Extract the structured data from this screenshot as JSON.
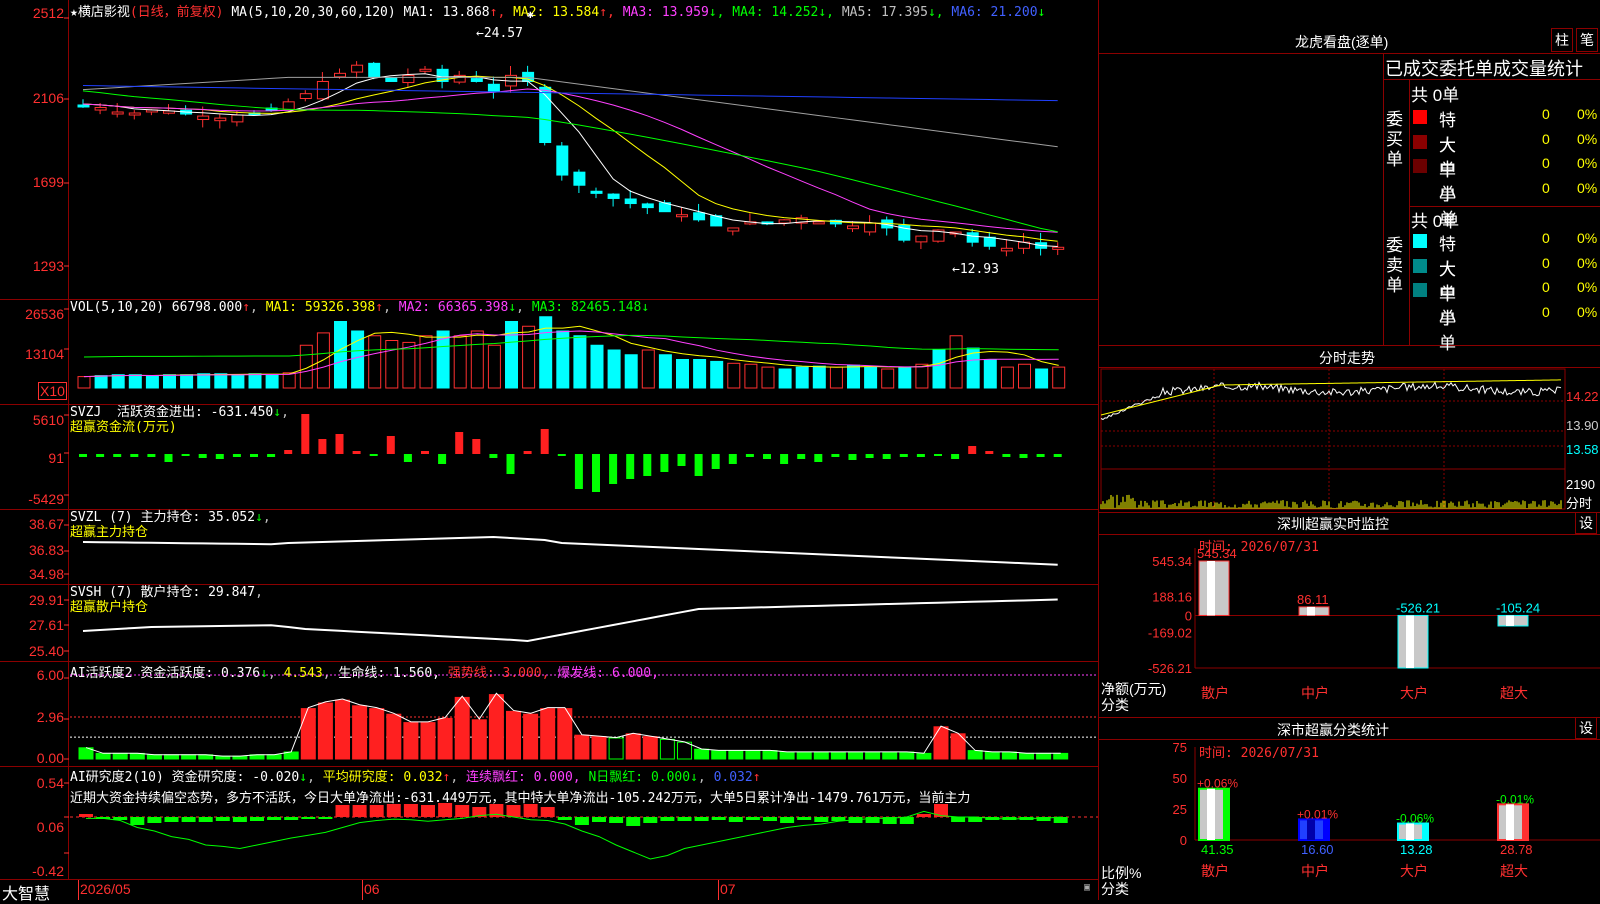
{
  "stock": {
    "name": "横店影视",
    "mode": "(日线，前复权)"
  },
  "main": {
    "ma_prefix": "MA(5,10,20,30,60,120)",
    "ma": [
      {
        "label": "MA1:",
        "value": "13.868",
        "arrow": "↑",
        "color": "#ffffff"
      },
      {
        "label": "MA2:",
        "value": "13.584",
        "arrow": "↑",
        "color": "#ffff00"
      },
      {
        "label": "MA3:",
        "value": "13.959",
        "arrow": "↓",
        "color": "#ff40ff"
      },
      {
        "label": "MA4:",
        "value": "14.252",
        "arrow": "↓",
        "color": "#00ff00"
      },
      {
        "label": "MA5:",
        "value": "17.395",
        "arrow": "↓",
        "color": "#c0c0c0"
      },
      {
        "label": "MA6:",
        "value": "21.200",
        "arrow": "↓",
        "color": "#4060ff"
      }
    ],
    "yticks": [
      "2512",
      "2106",
      "1699",
      "1293"
    ],
    "high_mark": "24.57",
    "low_mark": "12.93"
  },
  "vol": {
    "title": "VOL(5,10,20)",
    "value": "66798.000",
    "ma1": "MA1: 59326.398",
    "ma2": "MA2: 66365.398",
    "ma3": "MA3: 82465.148",
    "yticks": [
      "26536",
      "13104"
    ],
    "unit": "X10"
  },
  "svzj": {
    "title": "SVZJ",
    "desc": "活跃资金进出: -631.450",
    "sub": "超赢资金流(万元)",
    "yticks": [
      "5610",
      "91",
      "-5429"
    ]
  },
  "svzl": {
    "title": "SVZL (7)",
    "desc": "主力持仓: 35.052",
    "sub": "超赢主力持仓",
    "yticks": [
      "38.67",
      "36.83",
      "34.98"
    ]
  },
  "svsh": {
    "title": "SVSH (7)",
    "desc": "散户持仓: 29.847",
    "sub": "超赢散户持仓",
    "yticks": [
      "29.91",
      "27.61",
      "25.40"
    ]
  },
  "ai1": {
    "title": "AI活跃度2",
    "desc1": "资金活跃度: 0.376",
    "v2": "4.543",
    "desc3": "生命线: 1.560,",
    "desc4": "强势线: 3.000,",
    "desc5": "爆发线: 6.000,",
    "yticks": [
      "6.00",
      "2.96",
      "0.00"
    ]
  },
  "ai2": {
    "title": "AI研究度2(10)",
    "desc1": "资金研究度: -0.020",
    "desc2": "平均研究度: 0.032",
    "desc3": "连续飘红: 0.000,",
    "desc4": "N日飘红: 0.000",
    "desc5": "0.032",
    "yticks": [
      "0.54",
      "0.06",
      "-0.42"
    ],
    "comment": "近期大资金持续偏空态势，多方不活跃，今日大单净流出:-631.449万元，其中特大单净流出-105.242万元，大单5日累计净出-1479.761万元，当前主力"
  },
  "xaxis": {
    "brand": "大智慧",
    "labels": [
      "2026/05",
      "06",
      "07"
    ]
  },
  "lhb": {
    "title": "龙虎看盘(逐单)",
    "btn1": "柱",
    "btn2": "笔",
    "subtitle": "已成交委托单成交量统计",
    "buy_label": [
      "委",
      "买",
      "单"
    ],
    "sell_label": [
      "委",
      "卖",
      "单"
    ],
    "buy_total": "共 0单",
    "sell_total": "共 0单",
    "buy_rows": [
      {
        "name": "特大",
        "n": "0",
        "p": "0%",
        "color": "#ff0000"
      },
      {
        "name": "大单",
        "n": "0",
        "p": "0%",
        "color": "#8b0000"
      },
      {
        "name": "中单",
        "n": "0",
        "p": "0%",
        "color": "#6b0000"
      },
      {
        "name": "小单",
        "n": "0",
        "p": "0%",
        "color": ""
      }
    ],
    "sell_rows": [
      {
        "name": "特大",
        "n": "0",
        "p": "0%",
        "color": "#00ffff"
      },
      {
        "name": "大单",
        "n": "0",
        "p": "0%",
        "color": "#008b8b"
      },
      {
        "name": "中单",
        "n": "0",
        "p": "0%",
        "color": "#008080"
      },
      {
        "name": "小单",
        "n": "0",
        "p": "0%",
        "color": ""
      }
    ]
  },
  "fenshi": {
    "title": "分时走势",
    "yticks": [
      "14.22",
      "13.90",
      "13.58",
      "2190"
    ],
    "unit": "分时"
  },
  "monitor": {
    "title": "深圳超赢实时监控",
    "btn": "设",
    "time": "时间: 2026/07/31",
    "yticks": [
      "545.34",
      "188.16",
      "0",
      "-169.02",
      "-526.21"
    ],
    "ylabel": "净额(万元)",
    "xlabel": "分类",
    "cats": [
      "散户",
      "中户",
      "大户",
      "超大"
    ],
    "values": [
      545.34,
      86.11,
      -526.21,
      -105.24
    ],
    "vlabels": [
      "545.34",
      "86.11",
      "-526.21",
      "-105.24"
    ]
  },
  "classify": {
    "title": "深市超赢分类统计",
    "btn": "设",
    "time": "时间: 2026/07/31",
    "yticks": [
      "75",
      "50",
      "25",
      "0"
    ],
    "ylabel": "比例%",
    "xlabel": "分类",
    "cats": [
      "散户",
      "中户",
      "大户",
      "超大"
    ],
    "values": [
      41.35,
      16.6,
      13.28,
      28.78
    ],
    "vlabels": [
      "41.35",
      "16.60",
      "13.28",
      "28.78"
    ],
    "changes": [
      "+0.06%",
      "+0.01%",
      "-0.06%",
      "-0.01%"
    ]
  }
}
